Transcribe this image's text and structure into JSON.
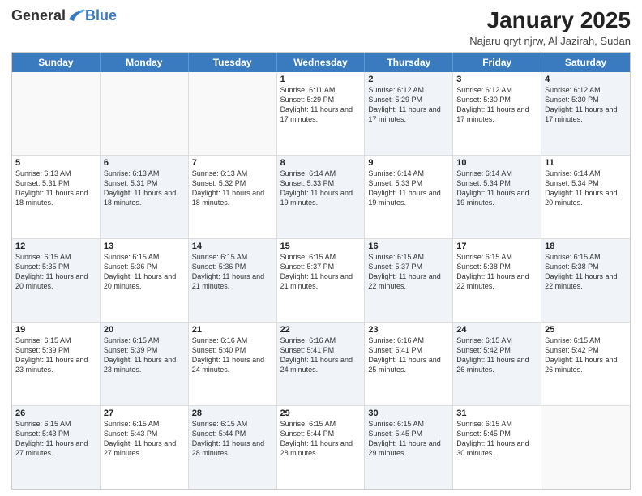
{
  "logo": {
    "general": "General",
    "blue": "Blue"
  },
  "title": "January 2025",
  "location": "Najaru qryt njrw, Al Jazirah, Sudan",
  "days": [
    "Sunday",
    "Monday",
    "Tuesday",
    "Wednesday",
    "Thursday",
    "Friday",
    "Saturday"
  ],
  "rows": [
    [
      {
        "day": "",
        "sunrise": "",
        "sunset": "",
        "daylight": "",
        "shaded": false,
        "empty": true
      },
      {
        "day": "",
        "sunrise": "",
        "sunset": "",
        "daylight": "",
        "shaded": false,
        "empty": true
      },
      {
        "day": "",
        "sunrise": "",
        "sunset": "",
        "daylight": "",
        "shaded": false,
        "empty": true
      },
      {
        "day": "1",
        "sunrise": "Sunrise: 6:11 AM",
        "sunset": "Sunset: 5:29 PM",
        "daylight": "Daylight: 11 hours and 17 minutes.",
        "shaded": false,
        "empty": false
      },
      {
        "day": "2",
        "sunrise": "Sunrise: 6:12 AM",
        "sunset": "Sunset: 5:29 PM",
        "daylight": "Daylight: 11 hours and 17 minutes.",
        "shaded": true,
        "empty": false
      },
      {
        "day": "3",
        "sunrise": "Sunrise: 6:12 AM",
        "sunset": "Sunset: 5:30 PM",
        "daylight": "Daylight: 11 hours and 17 minutes.",
        "shaded": false,
        "empty": false
      },
      {
        "day": "4",
        "sunrise": "Sunrise: 6:12 AM",
        "sunset": "Sunset: 5:30 PM",
        "daylight": "Daylight: 11 hours and 17 minutes.",
        "shaded": true,
        "empty": false
      }
    ],
    [
      {
        "day": "5",
        "sunrise": "Sunrise: 6:13 AM",
        "sunset": "Sunset: 5:31 PM",
        "daylight": "Daylight: 11 hours and 18 minutes.",
        "shaded": false,
        "empty": false
      },
      {
        "day": "6",
        "sunrise": "Sunrise: 6:13 AM",
        "sunset": "Sunset: 5:31 PM",
        "daylight": "Daylight: 11 hours and 18 minutes.",
        "shaded": true,
        "empty": false
      },
      {
        "day": "7",
        "sunrise": "Sunrise: 6:13 AM",
        "sunset": "Sunset: 5:32 PM",
        "daylight": "Daylight: 11 hours and 18 minutes.",
        "shaded": false,
        "empty": false
      },
      {
        "day": "8",
        "sunrise": "Sunrise: 6:14 AM",
        "sunset": "Sunset: 5:33 PM",
        "daylight": "Daylight: 11 hours and 19 minutes.",
        "shaded": true,
        "empty": false
      },
      {
        "day": "9",
        "sunrise": "Sunrise: 6:14 AM",
        "sunset": "Sunset: 5:33 PM",
        "daylight": "Daylight: 11 hours and 19 minutes.",
        "shaded": false,
        "empty": false
      },
      {
        "day": "10",
        "sunrise": "Sunrise: 6:14 AM",
        "sunset": "Sunset: 5:34 PM",
        "daylight": "Daylight: 11 hours and 19 minutes.",
        "shaded": true,
        "empty": false
      },
      {
        "day": "11",
        "sunrise": "Sunrise: 6:14 AM",
        "sunset": "Sunset: 5:34 PM",
        "daylight": "Daylight: 11 hours and 20 minutes.",
        "shaded": false,
        "empty": false
      }
    ],
    [
      {
        "day": "12",
        "sunrise": "Sunrise: 6:15 AM",
        "sunset": "Sunset: 5:35 PM",
        "daylight": "Daylight: 11 hours and 20 minutes.",
        "shaded": true,
        "empty": false
      },
      {
        "day": "13",
        "sunrise": "Sunrise: 6:15 AM",
        "sunset": "Sunset: 5:36 PM",
        "daylight": "Daylight: 11 hours and 20 minutes.",
        "shaded": false,
        "empty": false
      },
      {
        "day": "14",
        "sunrise": "Sunrise: 6:15 AM",
        "sunset": "Sunset: 5:36 PM",
        "daylight": "Daylight: 11 hours and 21 minutes.",
        "shaded": true,
        "empty": false
      },
      {
        "day": "15",
        "sunrise": "Sunrise: 6:15 AM",
        "sunset": "Sunset: 5:37 PM",
        "daylight": "Daylight: 11 hours and 21 minutes.",
        "shaded": false,
        "empty": false
      },
      {
        "day": "16",
        "sunrise": "Sunrise: 6:15 AM",
        "sunset": "Sunset: 5:37 PM",
        "daylight": "Daylight: 11 hours and 22 minutes.",
        "shaded": true,
        "empty": false
      },
      {
        "day": "17",
        "sunrise": "Sunrise: 6:15 AM",
        "sunset": "Sunset: 5:38 PM",
        "daylight": "Daylight: 11 hours and 22 minutes.",
        "shaded": false,
        "empty": false
      },
      {
        "day": "18",
        "sunrise": "Sunrise: 6:15 AM",
        "sunset": "Sunset: 5:38 PM",
        "daylight": "Daylight: 11 hours and 22 minutes.",
        "shaded": true,
        "empty": false
      }
    ],
    [
      {
        "day": "19",
        "sunrise": "Sunrise: 6:15 AM",
        "sunset": "Sunset: 5:39 PM",
        "daylight": "Daylight: 11 hours and 23 minutes.",
        "shaded": false,
        "empty": false
      },
      {
        "day": "20",
        "sunrise": "Sunrise: 6:15 AM",
        "sunset": "Sunset: 5:39 PM",
        "daylight": "Daylight: 11 hours and 23 minutes.",
        "shaded": true,
        "empty": false
      },
      {
        "day": "21",
        "sunrise": "Sunrise: 6:16 AM",
        "sunset": "Sunset: 5:40 PM",
        "daylight": "Daylight: 11 hours and 24 minutes.",
        "shaded": false,
        "empty": false
      },
      {
        "day": "22",
        "sunrise": "Sunrise: 6:16 AM",
        "sunset": "Sunset: 5:41 PM",
        "daylight": "Daylight: 11 hours and 24 minutes.",
        "shaded": true,
        "empty": false
      },
      {
        "day": "23",
        "sunrise": "Sunrise: 6:16 AM",
        "sunset": "Sunset: 5:41 PM",
        "daylight": "Daylight: 11 hours and 25 minutes.",
        "shaded": false,
        "empty": false
      },
      {
        "day": "24",
        "sunrise": "Sunrise: 6:15 AM",
        "sunset": "Sunset: 5:42 PM",
        "daylight": "Daylight: 11 hours and 26 minutes.",
        "shaded": true,
        "empty": false
      },
      {
        "day": "25",
        "sunrise": "Sunrise: 6:15 AM",
        "sunset": "Sunset: 5:42 PM",
        "daylight": "Daylight: 11 hours and 26 minutes.",
        "shaded": false,
        "empty": false
      }
    ],
    [
      {
        "day": "26",
        "sunrise": "Sunrise: 6:15 AM",
        "sunset": "Sunset: 5:43 PM",
        "daylight": "Daylight: 11 hours and 27 minutes.",
        "shaded": true,
        "empty": false
      },
      {
        "day": "27",
        "sunrise": "Sunrise: 6:15 AM",
        "sunset": "Sunset: 5:43 PM",
        "daylight": "Daylight: 11 hours and 27 minutes.",
        "shaded": false,
        "empty": false
      },
      {
        "day": "28",
        "sunrise": "Sunrise: 6:15 AM",
        "sunset": "Sunset: 5:44 PM",
        "daylight": "Daylight: 11 hours and 28 minutes.",
        "shaded": true,
        "empty": false
      },
      {
        "day": "29",
        "sunrise": "Sunrise: 6:15 AM",
        "sunset": "Sunset: 5:44 PM",
        "daylight": "Daylight: 11 hours and 28 minutes.",
        "shaded": false,
        "empty": false
      },
      {
        "day": "30",
        "sunrise": "Sunrise: 6:15 AM",
        "sunset": "Sunset: 5:45 PM",
        "daylight": "Daylight: 11 hours and 29 minutes.",
        "shaded": true,
        "empty": false
      },
      {
        "day": "31",
        "sunrise": "Sunrise: 6:15 AM",
        "sunset": "Sunset: 5:45 PM",
        "daylight": "Daylight: 11 hours and 30 minutes.",
        "shaded": false,
        "empty": false
      },
      {
        "day": "",
        "sunrise": "",
        "sunset": "",
        "daylight": "",
        "shaded": true,
        "empty": true
      }
    ]
  ]
}
